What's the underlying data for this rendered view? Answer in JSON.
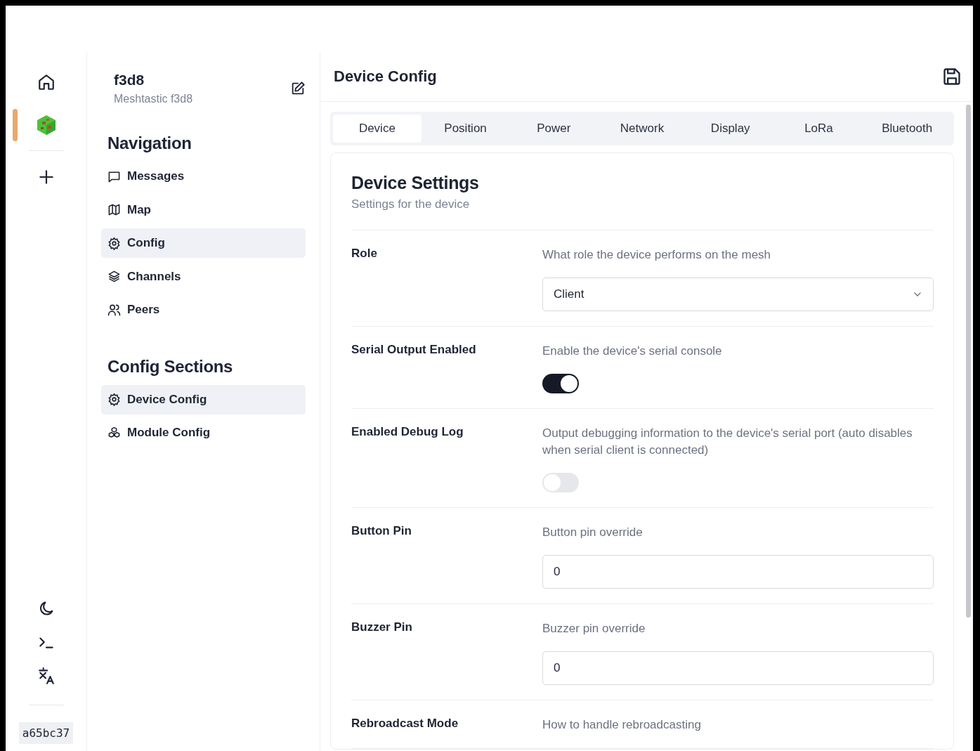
{
  "rail": {
    "version": "a65bc37"
  },
  "device": {
    "name": "f3d8",
    "subtitle": "Meshtastic f3d8"
  },
  "sidebar": {
    "sections": [
      {
        "title": "Navigation",
        "items": [
          {
            "label": "Messages",
            "selected": false
          },
          {
            "label": "Map",
            "selected": false
          },
          {
            "label": "Config",
            "selected": true
          },
          {
            "label": "Channels",
            "selected": false
          },
          {
            "label": "Peers",
            "selected": false
          }
        ]
      },
      {
        "title": "Config Sections",
        "items": [
          {
            "label": "Device Config",
            "selected": true
          },
          {
            "label": "Module Config",
            "selected": false
          }
        ]
      }
    ]
  },
  "main": {
    "title": "Device Config"
  },
  "tabs": [
    {
      "label": "Device",
      "selected": true
    },
    {
      "label": "Position",
      "selected": false
    },
    {
      "label": "Power",
      "selected": false
    },
    {
      "label": "Network",
      "selected": false
    },
    {
      "label": "Display",
      "selected": false
    },
    {
      "label": "LoRa",
      "selected": false
    },
    {
      "label": "Bluetooth",
      "selected": false
    }
  ],
  "card": {
    "title": "Device Settings",
    "subtitle": "Settings for the device"
  },
  "settings": [
    {
      "kind": "select",
      "label": "Role",
      "description": "What role the device performs on the mesh",
      "value": "Client"
    },
    {
      "kind": "toggle",
      "label": "Serial Output Enabled",
      "description": "Enable the device's serial console",
      "on": true
    },
    {
      "kind": "toggle",
      "label": "Enabled Debug Log",
      "description": "Output debugging information to the device's serial port (auto disables when serial client is connected)",
      "on": false
    },
    {
      "kind": "number",
      "label": "Button Pin",
      "description": "Button pin override",
      "value": "0"
    },
    {
      "kind": "number",
      "label": "Buzzer Pin",
      "description": "Buzzer pin override",
      "value": "0"
    },
    {
      "kind": "none",
      "label": "Rebroadcast Mode",
      "description": "How to handle rebroadcasting"
    }
  ]
}
